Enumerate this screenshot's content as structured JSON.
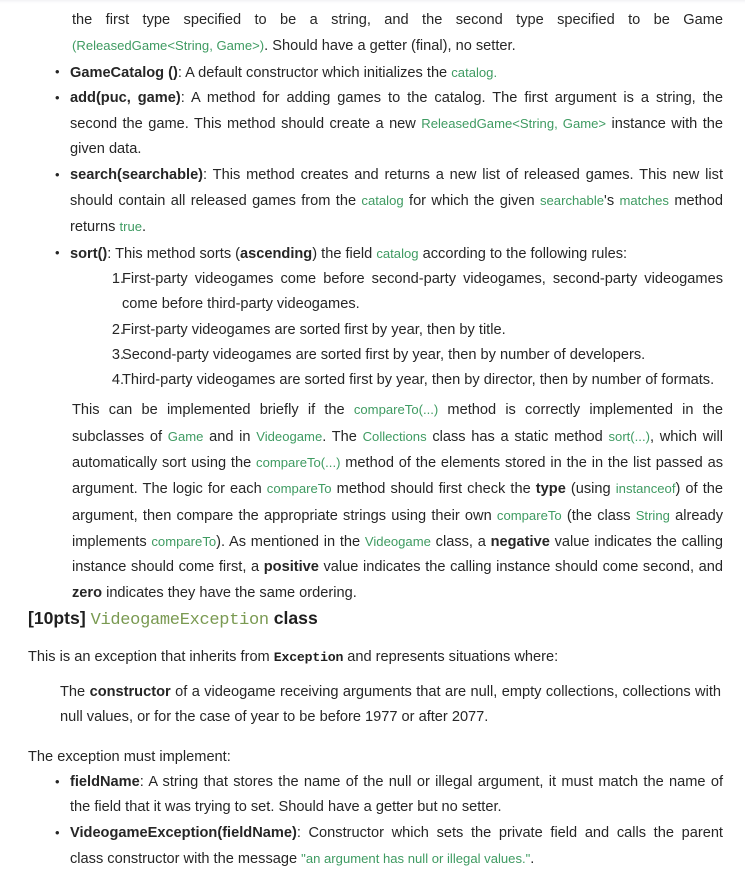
{
  "document": {
    "top_paragraph": {
      "segments": [
        {
          "t": "the first type specified to be a string, and the second type specified to be Game ",
          "s": "plain"
        },
        {
          "t": "(",
          "s": "code"
        },
        {
          "t": "ReleasedGame<String, Game>",
          "s": "code"
        },
        {
          "t": ")",
          "s": "code"
        },
        {
          "t": ". Should have a getter (final), no setter.",
          "s": "plain"
        }
      ],
      "line1": "the first type specified to be a string, and the second type specified to be Game",
      "code_ref": "(ReleasedGame<String, Game>)",
      "line2_tail": ". Should have a getter (final), no setter."
    },
    "method_bullets": [
      {
        "name": "GameCatalog ()",
        "body_pre": ": A default constructor which initializes the ",
        "code": "catalog",
        "body_post": "."
      },
      {
        "name": "add(puc, game)",
        "body_pre": ": A method for adding games to the catalog. The first argument is a string, the second the game. This method should create a new ",
        "code": "ReleasedGame<String, Game>",
        "body_post": " instance with the given data."
      },
      {
        "name": "search(searchable)",
        "body_pre": ": This method creates and returns a new list of released games. This new list should contain all released games from the ",
        "code": "catalog",
        "body_mid": " for which the given ",
        "code2": "searchable",
        "body_mid2": "'s ",
        "code3": "matches",
        "body_mid3": " method returns ",
        "code4": "true",
        "body_post": "."
      },
      {
        "name": "sort()",
        "body_pre": ": This method sorts (",
        "bold_word": "ascending",
        "body_mid": ") the field ",
        "code": "catalog",
        "body_post": " according to the following rules:"
      }
    ],
    "sort_rules": [
      {
        "num": "1.",
        "text": "First-party videogames come before second-party videogames, second-party videogames come before third-party videogames."
      },
      {
        "num": "2.",
        "text": "First-party videogames are sorted first by year, then by title."
      },
      {
        "num": "3.",
        "text": "Second-party videogames are sorted first by year, then by number of developers."
      },
      {
        "num": "4.",
        "text": "Third-party videogames are sorted first by year, then by director, then by number of formats."
      }
    ],
    "implementation_note": {
      "p1": "This can be implemented briefly if the ",
      "c1": "compareTo(...)",
      "p2": " method is correctly implemented in the subclasses of ",
      "c2": "Game",
      "p3": " and in ",
      "c3": "Videogame",
      "p4": ". The ",
      "c4": "Collections",
      "p5": " class has a static method ",
      "c5": "sort(...)",
      "p6": ", which will automatically sort using the ",
      "c6": "compareTo(...)",
      "p7": " method of the elements stored in the in the list passed as argument. The logic for each ",
      "c7": "compareTo",
      "p8": " method should first check the ",
      "b1": "type",
      "p9": " (using ",
      "c8": "instanceof",
      "p10": ") of the argument, then compare the appropriate strings using their own ",
      "c9": "compareTo",
      "p11": " (the class ",
      "c10": "String",
      "p12": " already implements ",
      "c11": "compareTo",
      "p13": "). As mentioned in the ",
      "c12": "Videogame",
      "p14": " class, a ",
      "b2": "negative",
      "p15": " value indicates the calling instance should come first, a ",
      "b3": "positive",
      "p16": " value indicates the calling instance should come second, and ",
      "b4": "zero",
      "p17": " indicates they have the same ordering."
    },
    "section_heading": {
      "points": "[10pts]",
      "class_name": "VideogameException",
      "suffix": "class"
    },
    "intro_line": {
      "pre": "This is an exception that inherits from ",
      "mono": "Exception",
      "post": " and represents situations where:"
    },
    "quote_block": {
      "pre": "The ",
      "bold": "constructor",
      "post": " of a videogame receiving arguments that are null, empty collections, collections with null values, or for the case of year to be before 1977 or after 2077."
    },
    "must_implement_label": "The exception must implement:",
    "exception_bullets": [
      {
        "name": "fieldName",
        "body": ": A string that stores the name of the null or illegal argument, it must match the name of the field that it was trying to set. Should have a getter but no setter."
      },
      {
        "name": "VideogameException(fieldName)",
        "body_pre": ": Constructor which sets the private field and calls the parent class constructor with the message ",
        "code": "\"an argument has null or illegal values.\"",
        "body_post": "."
      }
    ],
    "colors": {
      "body_text": "#262626",
      "inline_code_green": "#3f9b62",
      "heading_class_green": "#7a9a52",
      "background": "#ffffff"
    }
  }
}
